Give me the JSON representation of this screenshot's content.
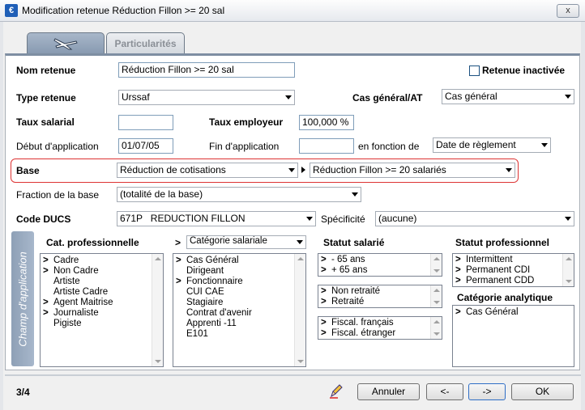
{
  "window": {
    "title": "Modification retenue Réduction Fillon >= 20 sal",
    "close_label": "x"
  },
  "tabs": [
    {
      "label": "",
      "icon": "plane-icon"
    },
    {
      "label": "Particularités"
    }
  ],
  "form": {
    "nom_retenue": {
      "label": "Nom retenue",
      "value": "Réduction Fillon >= 20 sal"
    },
    "retenue_inactivee": {
      "label": "Retenue inactivée",
      "checked": false
    },
    "type_retenue": {
      "label": "Type retenue",
      "value": "Urssaf"
    },
    "cas_general": {
      "label": "Cas général/AT",
      "value": "Cas général"
    },
    "taux_salarial": {
      "label": "Taux salarial",
      "value": ""
    },
    "taux_employeur": {
      "label": "Taux employeur",
      "value": "100,000 %"
    },
    "debut_application": {
      "label": "Début d'application",
      "value": "01/07/05"
    },
    "fin_application": {
      "label": "Fin d'application",
      "value": ""
    },
    "en_fonction_de": {
      "label": "en fonction de",
      "value": "Date de règlement"
    },
    "base": {
      "label": "Base",
      "value": "Réduction de cotisations",
      "sub_value": "Réduction Fillon >= 20 salariés"
    },
    "fraction_base": {
      "label": "Fraction de la base",
      "value": "(totalité de la base)"
    },
    "code_ducs": {
      "label": "Code DUCS",
      "value": "671P   REDUCTION FILLON"
    },
    "specificite": {
      "label": "Spécificité",
      "value": "(aucune)"
    }
  },
  "champ": {
    "label": "Champ d'application",
    "cat_professionnelle": {
      "header": "Cat. professionnelle",
      "items": [
        {
          "marker": ">",
          "text": "Cadre"
        },
        {
          "marker": ">",
          "text": "Non Cadre"
        },
        {
          "marker": "",
          "text": "Artiste"
        },
        {
          "marker": "",
          "text": "Artiste Cadre"
        },
        {
          "marker": ">",
          "text": "Agent Maitrise"
        },
        {
          "marker": ">",
          "text": "Journaliste"
        },
        {
          "marker": "",
          "text": "Pigiste"
        }
      ]
    },
    "categorie_salariale": {
      "prefix": ">",
      "header": "Catégorie salariale",
      "items": [
        {
          "marker": ">",
          "text": "Cas Général"
        },
        {
          "marker": "",
          "text": "Dirigeant"
        },
        {
          "marker": ">",
          "text": "Fonctionnaire"
        },
        {
          "marker": "",
          "text": "CUI CAE"
        },
        {
          "marker": "",
          "text": "Stagiaire"
        },
        {
          "marker": "",
          "text": "Contrat d'avenir"
        },
        {
          "marker": "",
          "text": "Apprenti -11"
        },
        {
          "marker": "",
          "text": "E101"
        }
      ]
    },
    "statut_salarie": {
      "header": "Statut salarié",
      "age": [
        {
          "marker": ">",
          "text": "- 65 ans"
        },
        {
          "marker": ">",
          "text": "+ 65 ans"
        }
      ],
      "retraite": [
        {
          "marker": ">",
          "text": "Non retraité"
        },
        {
          "marker": ">",
          "text": "Retraité"
        }
      ],
      "fiscal": [
        {
          "marker": ">",
          "text": "Fiscal. français"
        },
        {
          "marker": ">",
          "text": "Fiscal. étranger"
        }
      ]
    },
    "statut_professionnel": {
      "header": "Statut professionnel",
      "items": [
        {
          "marker": ">",
          "text": "Intermittent"
        },
        {
          "marker": ">",
          "text": "Permanent CDI"
        },
        {
          "marker": ">",
          "text": "Permanent CDD"
        }
      ]
    },
    "categorie_analytique": {
      "header": "Catégorie analytique",
      "items": [
        {
          "marker": ">",
          "text": "Cas Général"
        }
      ]
    }
  },
  "footer": {
    "page": "3/4",
    "annuler": "Annuler",
    "prev": "<-",
    "next": "->",
    "ok": "OK"
  }
}
